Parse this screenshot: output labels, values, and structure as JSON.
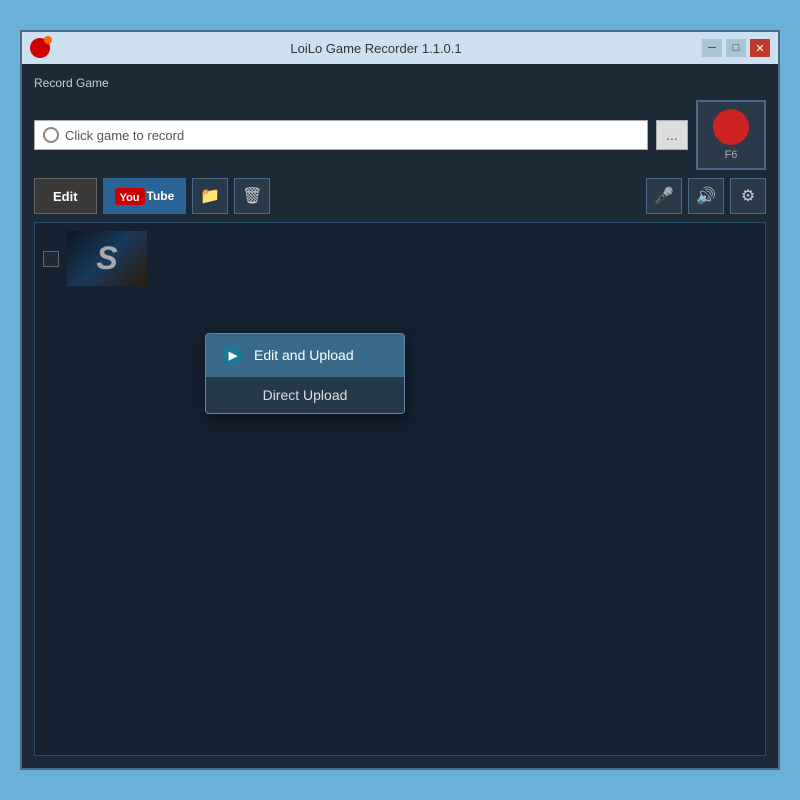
{
  "window": {
    "title": "LoiLo Game Recorder 1.1.0.1",
    "controls": {
      "minimize": "─",
      "maximize": "□",
      "close": "✕"
    }
  },
  "record_section": {
    "label": "Record Game",
    "input_placeholder": "Click game to record",
    "more_button": "...",
    "record_key": "F6"
  },
  "toolbar": {
    "edit_label": "Edit",
    "youtube_label": "YouTube",
    "mic_icon": "🎤",
    "speaker_icon": "🔊",
    "settings_icon": "⚙"
  },
  "dropdown": {
    "edit_upload_label": "Edit and Upload",
    "direct_upload_label": "Direct Upload"
  },
  "video_list": [
    {
      "thumb_letter": "S",
      "checked": false
    }
  ]
}
